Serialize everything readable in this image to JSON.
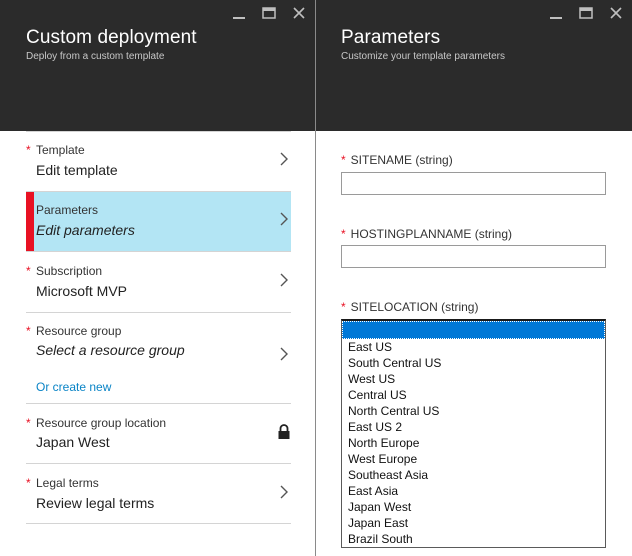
{
  "left_blade": {
    "title": "Custom deployment",
    "subtitle": "Deploy from a custom template",
    "items": [
      {
        "label": "Template",
        "value": "Edit template"
      },
      {
        "label": "Parameters",
        "value": "Edit parameters"
      },
      {
        "label": "Subscription",
        "value": "Microsoft MVP"
      },
      {
        "label": "Resource group",
        "value": "Select a resource group",
        "link": "Or create new"
      },
      {
        "label": "Resource group location",
        "value": "Japan West"
      },
      {
        "label": "Legal terms",
        "value": "Review legal terms"
      }
    ]
  },
  "right_blade": {
    "title": "Parameters",
    "subtitle": "Customize your template parameters",
    "fields": [
      {
        "label": "SITENAME (string)",
        "value": ""
      },
      {
        "label": "HOSTINGPLANNAME (string)",
        "value": ""
      },
      {
        "label": "SITELOCATION (string)"
      }
    ],
    "location_options": [
      "East US",
      "South Central US",
      "West US",
      "Central US",
      "North Central US",
      "East US 2",
      "North Europe",
      "West Europe",
      "Southeast Asia",
      "East Asia",
      "Japan West",
      "Japan East",
      "Brazil South"
    ]
  },
  "icons": [
    "minimize-icon",
    "maximize-icon",
    "close-icon",
    "chevron-right-icon",
    "lock-icon"
  ],
  "colors": {
    "header_bg": "#2b2b2b",
    "required_star": "#e81123",
    "active_item_bg": "#b3e5f4",
    "link": "#0a84c6",
    "dropdown_selected": "#0078d7"
  }
}
